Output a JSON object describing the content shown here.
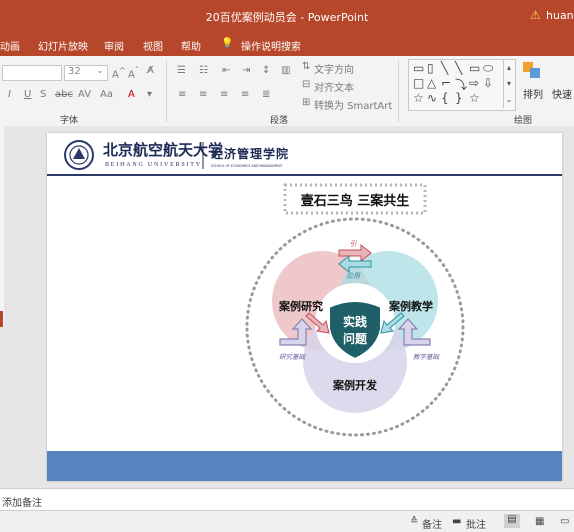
{
  "window": {
    "title": "20百优案例动员会  -  PowerPoint",
    "user": "huan",
    "warning_icon": "warning-icon"
  },
  "menu": [
    "动画",
    "幻灯片放映",
    "审阅",
    "视图",
    "帮助",
    "操作说明搜索"
  ],
  "ribbon": {
    "font_size": "32",
    "groups": {
      "font": "字体",
      "paragraph": "段落",
      "drawing": "绘图"
    },
    "text_direction": "文字方向",
    "align_text": "对齐文本",
    "smartart": "转换为 SmartArt",
    "arrange": "排列",
    "quick_styles": "快速"
  },
  "slide": {
    "university_cn": "北京航空航天大学",
    "university_en": "BEIHANG UNIVERSITY",
    "school_cn": "经济管理学院",
    "school_en": "SCHOOL OF ECONOMICS AND MANAGEMENT",
    "headline": "壹石三鸟  三案共生",
    "diagram": {
      "center": [
        "实践",
        "问题"
      ],
      "left": "案例研究",
      "right": "案例教学",
      "bottom": "案例开发",
      "top_arrow_top": "引",
      "top_arrow_bottom": "应用",
      "left_arrow": "研究基础",
      "right_arrow": "教学基础"
    },
    "colors": {
      "left_petal": "#e8b5b8",
      "right_petal": "#a8dde3",
      "bottom_petal": "#d8d4ea",
      "shield": "#1f5f68",
      "arrow": "#8a7fb5",
      "footer": "#5584bf"
    }
  },
  "notes": {
    "placeholder": "添加备注"
  },
  "status": {
    "notes_btn": "备注",
    "comments_btn": "批注"
  }
}
